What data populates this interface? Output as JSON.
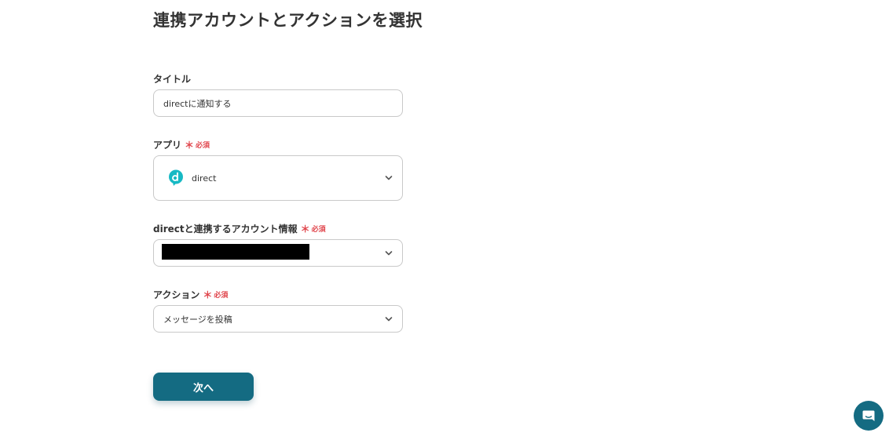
{
  "page_title": "連携アカウントとアクションを選択",
  "required_mark": "＊",
  "required_text": "必須",
  "title_field": {
    "label": "タイトル",
    "value": "directに通知する"
  },
  "app_field": {
    "label": "アプリ",
    "value": "direct",
    "icon": "direct-logo-icon",
    "brand_color": "#17b9c4"
  },
  "account_field": {
    "label": "directと連携するアカウント情報",
    "value_redacted": true
  },
  "action_field": {
    "label": "アクション",
    "value": "メッセージを投稿"
  },
  "next_button": {
    "label": "次へ",
    "color": "#146b82"
  },
  "chat_launcher": {
    "icon": "chat-bubble-icon",
    "color": "#146b82"
  }
}
